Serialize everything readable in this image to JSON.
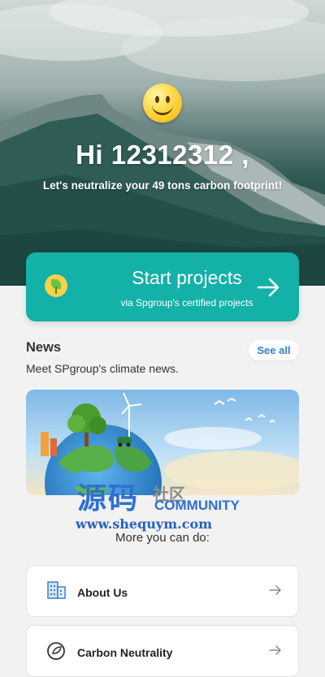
{
  "hero": {
    "greeting": "Hi 12312312 ,",
    "subtitle": "Let's neutralize your 49 tons carbon footprint!",
    "emoji_icon": "smiley-face-icon"
  },
  "start_projects": {
    "title": "Start projects",
    "subtitle": "via Spgroup's certified projects",
    "icon": "lightbulb-plant-icon",
    "arrow_icon": "arrow-right-icon",
    "color": "#13b1a8"
  },
  "news": {
    "title": "News",
    "subtitle": "Meet SPgroup's climate news.",
    "see_all_label": "See all",
    "image_icon": "earth-illustration-icon"
  },
  "watermark": {
    "main": "源码",
    "cn": "社区",
    "community": "COMMUNITY",
    "url": "www.shequym.com"
  },
  "more": {
    "title": "More you can do:",
    "items": [
      {
        "label": "About Us",
        "icon": "building-icon"
      },
      {
        "label": "Carbon Neutrality",
        "icon": "leaf-circle-icon"
      }
    ]
  }
}
